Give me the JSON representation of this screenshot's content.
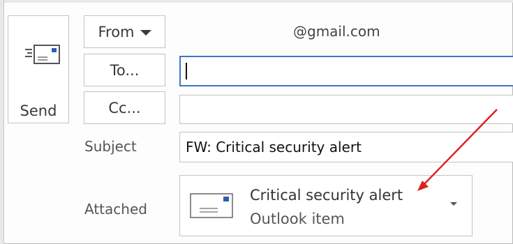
{
  "compose": {
    "send_label": "Send",
    "from_label": "From",
    "from_account": "@gmail.com",
    "to_label": "To...",
    "to_value": "",
    "cc_label": "Cc...",
    "cc_value": "",
    "subject_label": "Subject",
    "subject_value": "FW: Critical security alert",
    "attached_label": "Attached",
    "attachment": {
      "name": "Critical security alert",
      "type": "Outlook item",
      "icon": "envelope-icon"
    }
  },
  "colors": {
    "focus_border": "#3b78c6",
    "annotation_arrow": "#e02020",
    "envelope_accent": "#2e5fb0"
  }
}
